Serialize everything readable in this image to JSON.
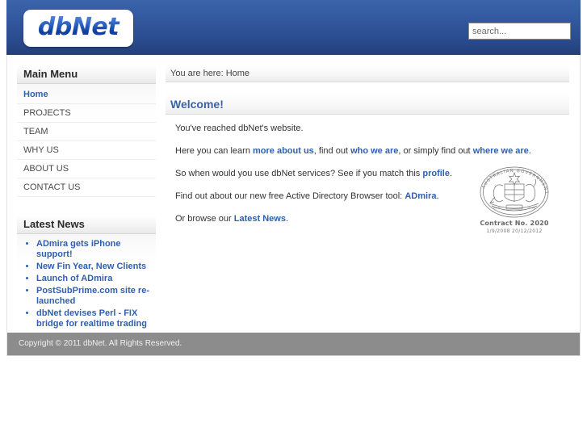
{
  "site": {
    "logo_text": "dbNet",
    "accent_blue": "#2f5fae",
    "header_gradient_top": "#3a64ab",
    "header_gradient_bottom": "#233f79",
    "footer_bg": "#8c8c8c"
  },
  "search": {
    "placeholder": "search...",
    "value": ""
  },
  "sidebar": {
    "main_menu": {
      "title": "Main Menu",
      "items": [
        {
          "label": "Home",
          "active": true
        },
        {
          "label": "PROJECTS",
          "active": false
        },
        {
          "label": "TEAM",
          "active": false
        },
        {
          "label": "WHY US",
          "active": false
        },
        {
          "label": "ABOUT US",
          "active": false
        },
        {
          "label": "CONTACT US",
          "active": false
        }
      ]
    },
    "latest_news": {
      "title": "Latest News",
      "items": [
        {
          "label": "ADmira gets iPhone support!"
        },
        {
          "label": "New Fin Year, New Clients"
        },
        {
          "label": "Launch of ADmira"
        },
        {
          "label": "PostSubPrime.com site re-launched"
        },
        {
          "label": "dbNet devises Perl - FIX bridge for realtime trading"
        }
      ]
    }
  },
  "content": {
    "breadcrumb": "You are here: Home",
    "article_title": "Welcome!",
    "paragraphs": {
      "p1": "You've reached dbNet's website.",
      "p2_a": "Here you can learn ",
      "p2_link1": "more about us",
      "p2_b": ", find out ",
      "p2_link2": "who we are",
      "p2_c": ", or simply find out ",
      "p2_link3": "where we are",
      "p2_d": ".",
      "p3_a": "So when would you use dbNet services? See if you match this ",
      "p3_link": "profile",
      "p3_b": ".",
      "p4_a": "Find out about our new free Active Directory Browser tool: ",
      "p4_link": "ADmira",
      "p4_b": ".",
      "p5_a": "Or browse our ",
      "p5_link": "Latest News",
      "p5_b": "."
    }
  },
  "seal": {
    "ring_text": "AUSTRALIAN GOVERNMENT",
    "caption": "Contract No. 2020",
    "dates": "1/9/2008    20/12/2012"
  },
  "footer": {
    "copyright": "Copyright © 2011 dbNet. All Rights Reserved."
  }
}
